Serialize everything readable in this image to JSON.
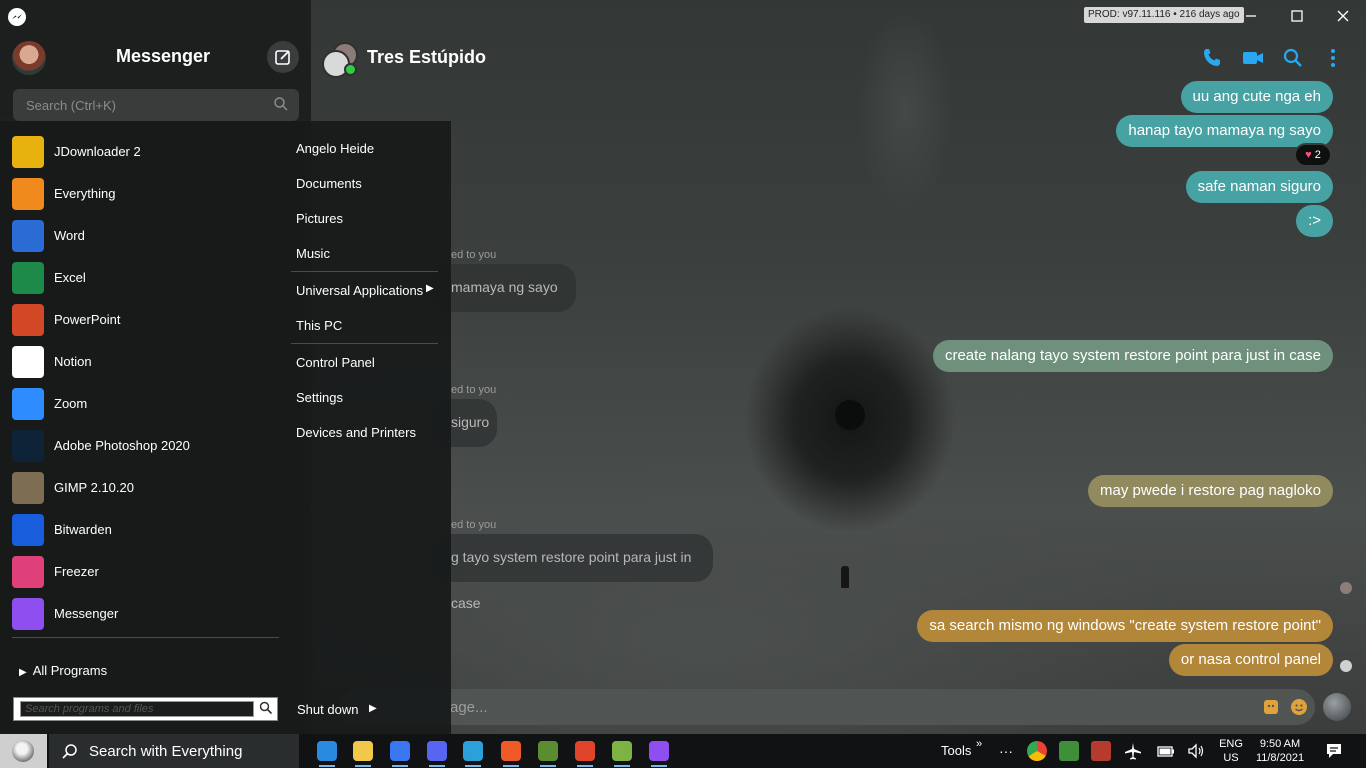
{
  "window": {
    "version_badge": "PROD: v97.11.116 • 216 days ago"
  },
  "sidebar": {
    "title": "Messenger",
    "search_placeholder": "Search (Ctrl+K)"
  },
  "chat": {
    "name": "Tres Estúpido",
    "messages": {
      "m1": "uu ang cute nga eh",
      "m2": "hanap tayo mamaya ng sayo",
      "reaction_count": "2",
      "m3": "safe naman siguro",
      "m4": ":>",
      "reply1_label": "ed to you",
      "reply1_text": "mamaya ng sayo",
      "m5": "create nalang tayo system restore point para just in case",
      "reply2_label": "ed to you",
      "reply2_text": "siguro",
      "m6": "may pwede i restore pag nagloko",
      "reply3_label": "ed to you",
      "reply3_text": "g tayo system restore point para just in case",
      "m7": "sa search mismo ng windows \"create system restore point\"",
      "m8": "or nasa control panel"
    },
    "composer_placeholder": "age..."
  },
  "start_menu": {
    "apps": [
      {
        "label": "JDownloader 2",
        "icon": "jdownloader-icon",
        "color": "#e8b20e"
      },
      {
        "label": "Everything",
        "icon": "everything-search-icon",
        "color": "#f08a1c"
      },
      {
        "label": "Word",
        "icon": "word-icon",
        "color": "#2b6bd6"
      },
      {
        "label": "Excel",
        "icon": "excel-icon",
        "color": "#1d8a4a"
      },
      {
        "label": "PowerPoint",
        "icon": "powerpoint-icon",
        "color": "#d24726"
      },
      {
        "label": "Notion",
        "icon": "notion-icon",
        "color": "#ffffff"
      },
      {
        "label": "Zoom",
        "icon": "zoom-icon",
        "color": "#2d8cff"
      },
      {
        "label": "Adobe Photoshop 2020",
        "icon": "photoshop-icon",
        "color": "#0f2338"
      },
      {
        "label": "GIMP 2.10.20",
        "icon": "gimp-icon",
        "color": "#7d6d53"
      },
      {
        "label": "Bitwarden",
        "icon": "bitwarden-icon",
        "color": "#175ddc"
      },
      {
        "label": "Freezer",
        "icon": "freezer-icon",
        "color": "#e0407a"
      },
      {
        "label": "Messenger",
        "icon": "messenger-icon",
        "color": "#8f4ef0"
      }
    ],
    "all_programs": "All Programs",
    "search_placeholder": "Search programs and files",
    "places": {
      "user": "Angelo Heide",
      "documents": "Documents",
      "pictures": "Pictures",
      "music": "Music",
      "universal_apps": "Universal Applications",
      "this_pc": "This PC",
      "control_panel": "Control Panel",
      "settings": "Settings",
      "devices": "Devices and Printers"
    },
    "shutdown": "Shut down"
  },
  "taskbar": {
    "search_label": "Search with Everything",
    "tools": "Tools",
    "lang_top": "ENG",
    "lang_bottom": "US",
    "time": "9:50 AM",
    "date": "11/8/2021",
    "pinned": [
      {
        "icon": "vscode-icon",
        "color": "#2a8ae0"
      },
      {
        "icon": "file-explorer-icon",
        "color": "#f2c84b"
      },
      {
        "icon": "signal-icon",
        "color": "#3a76f0"
      },
      {
        "icon": "discord-icon",
        "color": "#5865f2"
      },
      {
        "icon": "telegram-icon",
        "color": "#2aa1da"
      },
      {
        "icon": "brave-icon",
        "color": "#f05a28"
      },
      {
        "icon": "minecraft-icon",
        "color": "#5b8c32"
      },
      {
        "icon": "brave-beta-icon",
        "color": "#e0452b"
      },
      {
        "icon": "android-studio-icon",
        "color": "#7cb342"
      },
      {
        "icon": "messenger-icon",
        "color": "#8f4ef0"
      }
    ]
  }
}
